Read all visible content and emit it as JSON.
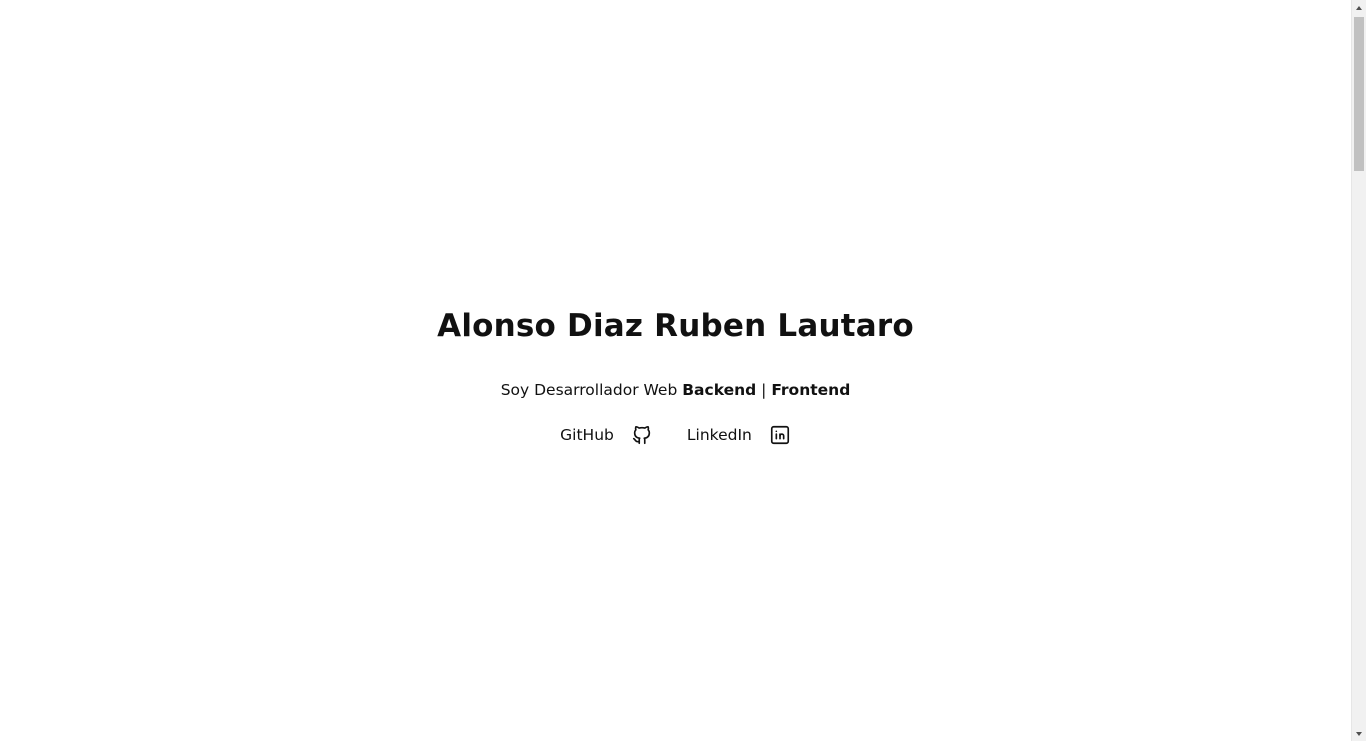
{
  "hero": {
    "title": "Alonso Diaz Ruben Lautaro",
    "subtitle_prefix": "Soy Desarrollador Web ",
    "subtitle_backend": "Backend",
    "subtitle_separator": " | ",
    "subtitle_frontend": "Frontend"
  },
  "links": {
    "github_label": "GitHub",
    "github_icon": "github-icon",
    "linkedin_label": "LinkedIn",
    "linkedin_icon": "linkedin-icon"
  },
  "colors": {
    "background": "#ffffff",
    "text": "#111111",
    "scrollbar_track": "#f1f1f1",
    "scrollbar_thumb": "#c1c1c1"
  }
}
